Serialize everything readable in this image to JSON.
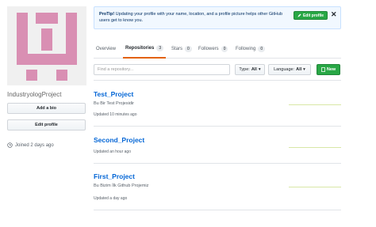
{
  "profile": {
    "username": "IndustryologProject",
    "add_bio_label": "Add a bio",
    "edit_profile_label": "Edit profile",
    "joined_text": "Joined 2 days ago"
  },
  "protip": {
    "lead": "ProTip!",
    "text": " Updating your profile with your name, location, and a profile picture helps other GitHub users get to know you.",
    "button_label": "Edit profile",
    "close_glyph": "✕"
  },
  "tabs": [
    {
      "label": "Overview",
      "count": ""
    },
    {
      "label": "Repositories",
      "count": "3"
    },
    {
      "label": "Stars",
      "count": "0"
    },
    {
      "label": "Followers",
      "count": "0"
    },
    {
      "label": "Following",
      "count": "0"
    }
  ],
  "filters": {
    "search_placeholder": "Find a repository...",
    "type_label": "Type:",
    "type_value": "All",
    "language_label": "Language:",
    "language_value": "All",
    "new_label": "New"
  },
  "repos": [
    {
      "name": "Test_Project",
      "description": "Bu Bir Test Projesidir",
      "updated": "Updated 10 minutes ago"
    },
    {
      "name": "Second_Project",
      "description": "",
      "updated": "Updated an hour ago"
    },
    {
      "name": "First_Project",
      "description": "Bu Bizim İlk Github Projemiz",
      "updated": "Updated a day ago"
    }
  ],
  "colors": {
    "accent_green": "#28a745",
    "link_blue": "#0366d6",
    "tab_underline": "#e36209",
    "avatar_pink": "#d98fb3"
  }
}
